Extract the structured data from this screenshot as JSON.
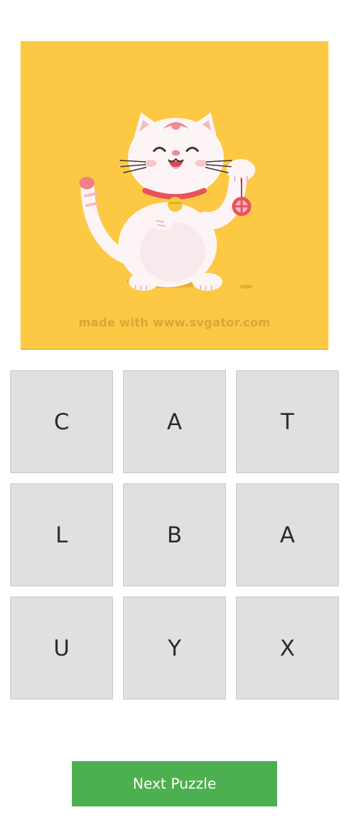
{
  "illustration": {
    "watermark": "made with www.svgator.com",
    "background_color": "#fdc944",
    "subject": "maneki-neko-cat-icon"
  },
  "tiles": [
    "C",
    "A",
    "T",
    "L",
    "B",
    "A",
    "U",
    "Y",
    "X"
  ],
  "next_button": {
    "label": "Next Puzzle",
    "color": "#4caf50"
  }
}
